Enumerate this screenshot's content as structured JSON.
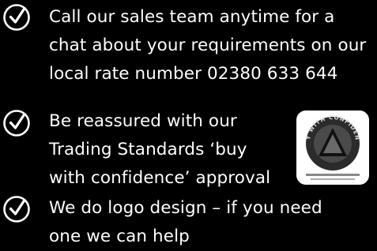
{
  "features": [
    {
      "lines": [
        "Call our sales team anytime for a",
        "chat about your requirements on our",
        "local rate number 02380 633 644"
      ],
      "icon": "check-circle-icon"
    },
    {
      "lines": [
        "Be reassured with our",
        "Trading Standards ‘buy",
        "with confidence’ approval"
      ],
      "icon": "check-circle-icon"
    },
    {
      "lines": [
        "We do logo design – if you need",
        "one we can help"
      ],
      "icon": "check-circle-icon"
    }
  ],
  "badge": {
    "text": "BUY WITH CONFIDENCE",
    "icon": "buy-with-confidence-logo"
  },
  "colors": {
    "background": "#000000",
    "text": "#ffffff"
  }
}
